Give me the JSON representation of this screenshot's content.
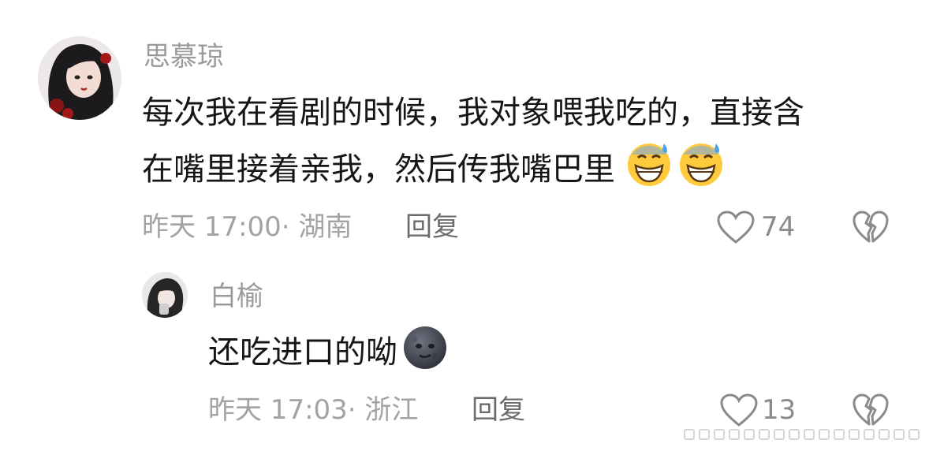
{
  "comments": [
    {
      "username": "思慕琼",
      "text_line1": "每次我在看剧的时候，我对象喂我吃的，直接含",
      "text_line2": "在嘴里接着亲我，然后传我嘴巴里",
      "emojis": [
        "grinning-sweat-emoji",
        "grinning-sweat-emoji"
      ],
      "meta": "昨天 17:00· 湖南",
      "reply_label": "回复",
      "like_count": "74"
    },
    {
      "username": "白榆",
      "text": "还吃进口的呦",
      "emojis": [
        "new-moon-face-emoji"
      ],
      "meta": "昨天 17:03· 浙江",
      "reply_label": "回复",
      "like_count": "13"
    }
  ],
  "colors": {
    "username": "#9a9a9a",
    "text": "#161616",
    "meta": "#a3a3a3",
    "icon": "#8a8a8a"
  }
}
